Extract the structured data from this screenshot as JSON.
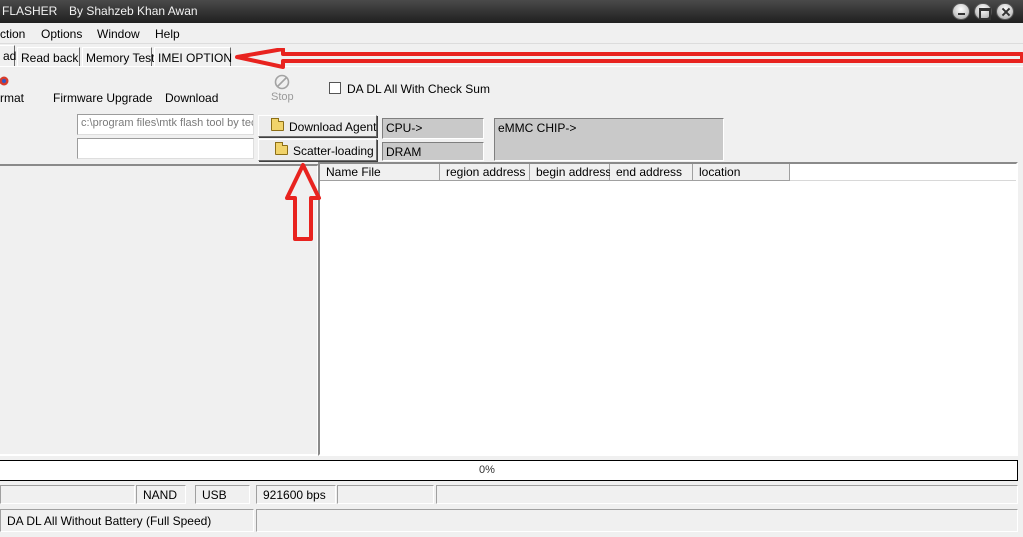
{
  "window": {
    "title_left": "FLASHER",
    "title_right": "By Shahzeb Khan Awan"
  },
  "menu": [
    "ction",
    "Options",
    "Window",
    "Help"
  ],
  "tabs": [
    "ad",
    "Read back",
    "Memory Test",
    "IMEI OPTION"
  ],
  "toolbar": {
    "format_label": "rmat",
    "firmware_upgrade_label": "Firmware Upgrade",
    "download_label": "Download",
    "stop_label": "Stop",
    "checksum_label": "DA DL All With Check Sum",
    "checksum_checked": false
  },
  "fields": {
    "download_agent_path": "c:\\program files\\mtk flash tool by tec",
    "scatter_path": ""
  },
  "buttons": {
    "download_agent": "Download Agent",
    "scatter_loading": "Scatter-loading"
  },
  "info": {
    "cpu": "CPU->",
    "dram": "DRAM",
    "emmc": "eMMC CHIP->"
  },
  "table": {
    "columns": [
      "Name File",
      "region address",
      "begin address",
      "end address",
      "location"
    ]
  },
  "progress": {
    "percent_text": "0%",
    "value": 0
  },
  "status": {
    "storage": "NAND",
    "interface": "USB",
    "baud": "921600 bps",
    "mode": "DA DL All Without Battery (Full Speed)"
  },
  "colors": {
    "annotation": "#e8231f",
    "titlebar": "#2b2b2b",
    "progress_fill": "#3a6fd8"
  }
}
